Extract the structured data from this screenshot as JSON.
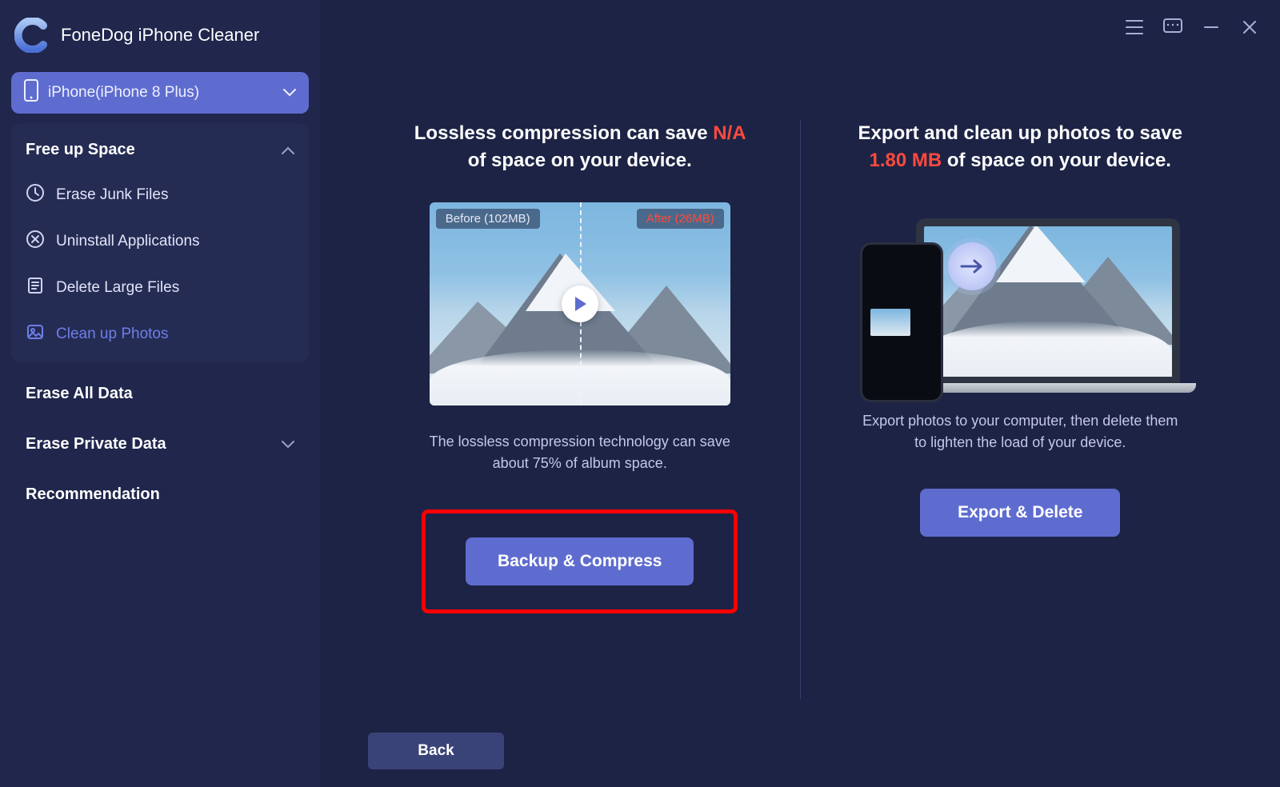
{
  "app": {
    "title": "FoneDog iPhone Cleaner"
  },
  "device": {
    "label": "iPhone(iPhone 8 Plus)"
  },
  "sidebar": {
    "free_heading": "Free up Space",
    "items": [
      {
        "label": "Erase Junk Files"
      },
      {
        "label": "Uninstall Applications"
      },
      {
        "label": "Delete Large Files"
      },
      {
        "label": "Clean up Photos"
      }
    ],
    "erase_all": "Erase All Data",
    "erase_private": "Erase Private Data",
    "recommendation": "Recommendation"
  },
  "compress": {
    "title_pre": "Lossless compression can save ",
    "title_em": "N/A",
    "title_post": " of space on your device.",
    "before_tag": "Before (102MB)",
    "after_tag": "After (26MB)",
    "desc": "The lossless compression technology can save about 75% of album space.",
    "button": "Backup & Compress"
  },
  "export": {
    "title_pre": "Export and clean up photos to save ",
    "title_em": "1.80 MB",
    "title_post": " of space on your device.",
    "desc": "Export photos to your computer, then delete them to lighten the load of your device.",
    "button": "Export & Delete"
  },
  "back_label": "Back"
}
